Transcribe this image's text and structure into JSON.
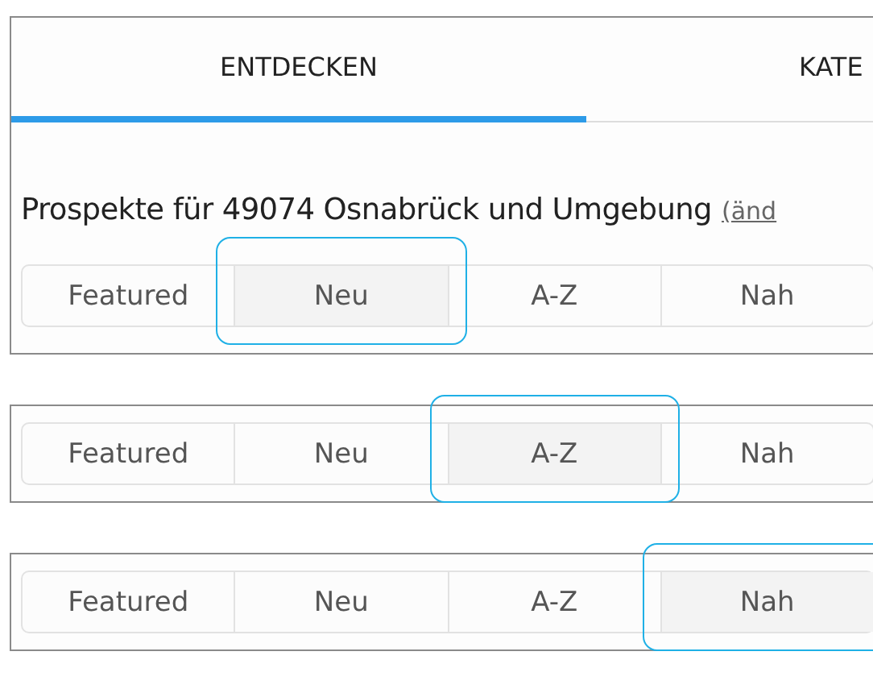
{
  "panels": [
    {
      "tabs": [
        {
          "label": "ENTDECKEN",
          "selected": true
        },
        {
          "label": "KATE",
          "selected": false
        }
      ],
      "heading": {
        "text": "Prospekte für 49074 Osnabrück und Umgebung",
        "link": "(änd"
      },
      "segments": [
        {
          "label": "Featured",
          "selected": false
        },
        {
          "label": "Neu",
          "selected": true
        },
        {
          "label": "A-Z",
          "selected": false
        },
        {
          "label": "Nah",
          "selected": false
        }
      ]
    },
    {
      "segments": [
        {
          "label": "Featured",
          "selected": false
        },
        {
          "label": "Neu",
          "selected": false
        },
        {
          "label": "A-Z",
          "selected": true
        },
        {
          "label": "Nah",
          "selected": false
        }
      ]
    },
    {
      "segments": [
        {
          "label": "Featured",
          "selected": false
        },
        {
          "label": "Neu",
          "selected": false
        },
        {
          "label": "A-Z",
          "selected": false
        },
        {
          "label": "Nah",
          "selected": true
        }
      ]
    }
  ]
}
